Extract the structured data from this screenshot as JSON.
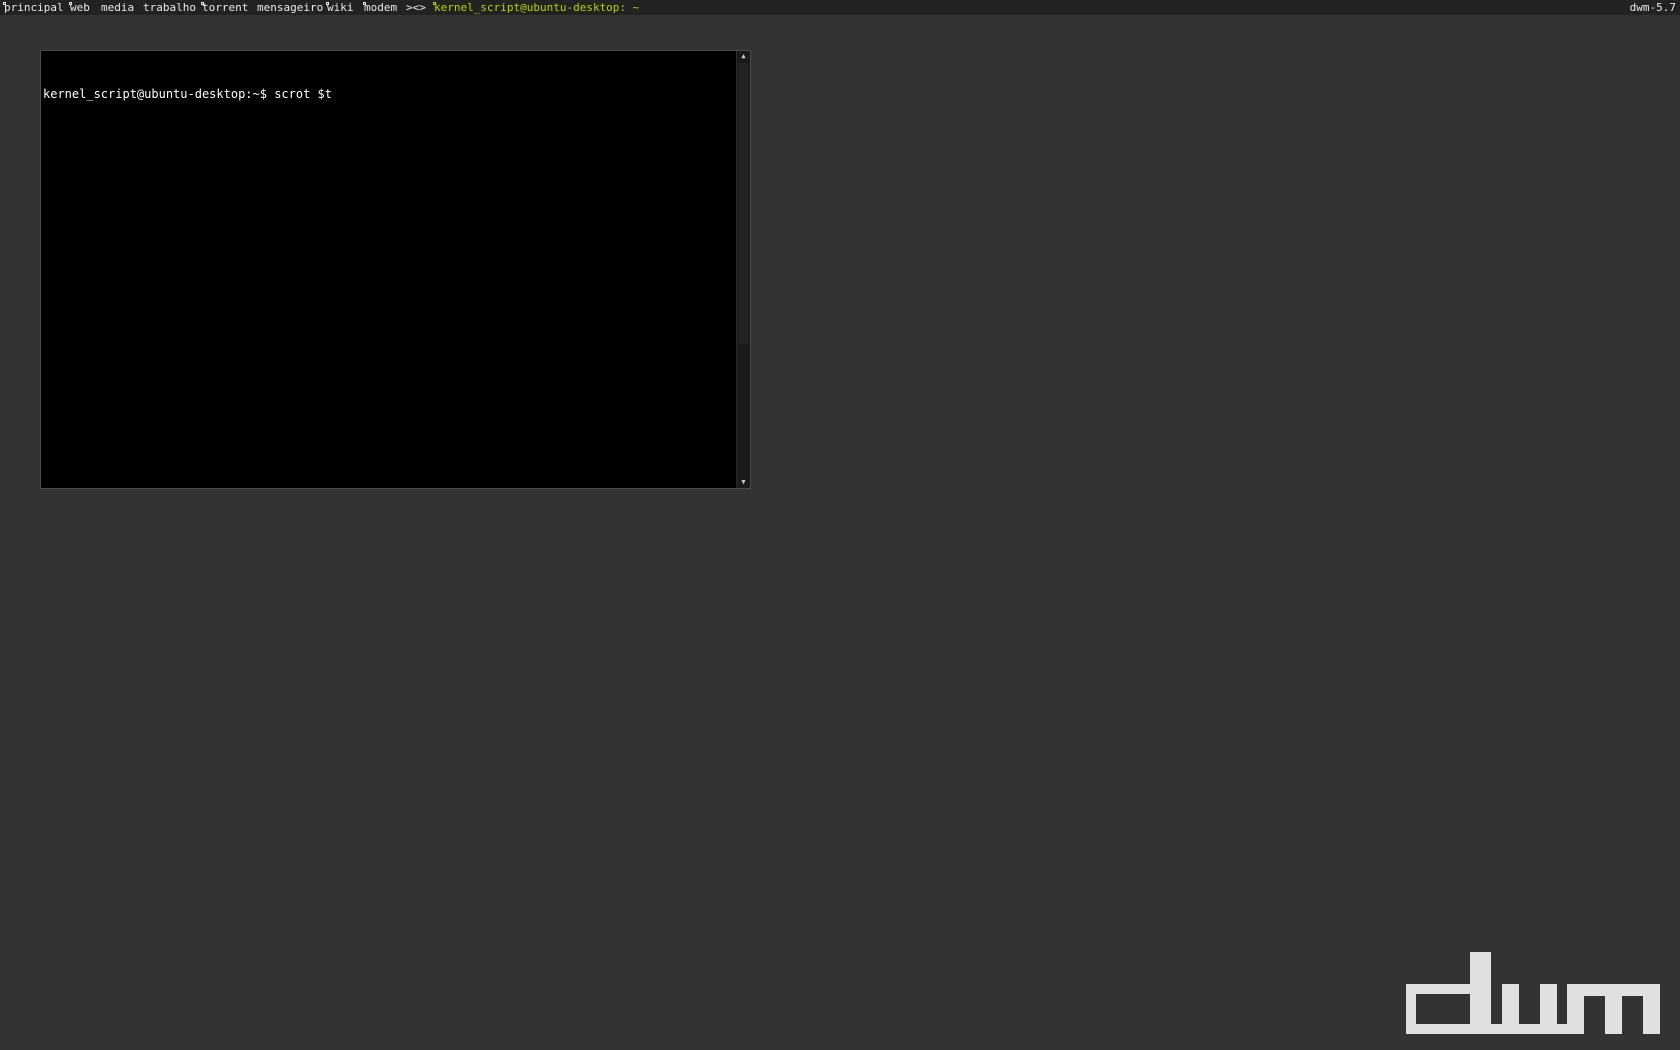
{
  "bar": {
    "tags": [
      {
        "label": "principal",
        "selected": true,
        "occupied": true
      },
      {
        "label": "web",
        "selected": false,
        "occupied": true
      },
      {
        "label": "media",
        "selected": false,
        "occupied": false
      },
      {
        "label": "trabalho",
        "selected": false,
        "occupied": false
      },
      {
        "label": "torrent",
        "selected": false,
        "occupied": true
      },
      {
        "label": "mensageiro",
        "selected": false,
        "occupied": false
      },
      {
        "label": "wiki",
        "selected": false,
        "occupied": true
      },
      {
        "label": "modem",
        "selected": false,
        "occupied": true
      }
    ],
    "layout_symbol": "><>",
    "window_title": "kernel_script@ubuntu-desktop: ~",
    "status": "dwm-5.7"
  },
  "terminal": {
    "lines": [
      "kernel_script@ubuntu-desktop:~$ scrot $t"
    ],
    "scroll_fraction": 0.68
  },
  "logo": {
    "name": "dwm-logo",
    "text": "dwm"
  },
  "colors": {
    "background": "#333333",
    "bar_background": "#222222",
    "selected_tag": "#b5d300",
    "bar_text": "#e8e8e8",
    "terminal_background": "#000000",
    "terminal_text": "#ffffff",
    "logo": "#e0e0e0"
  }
}
